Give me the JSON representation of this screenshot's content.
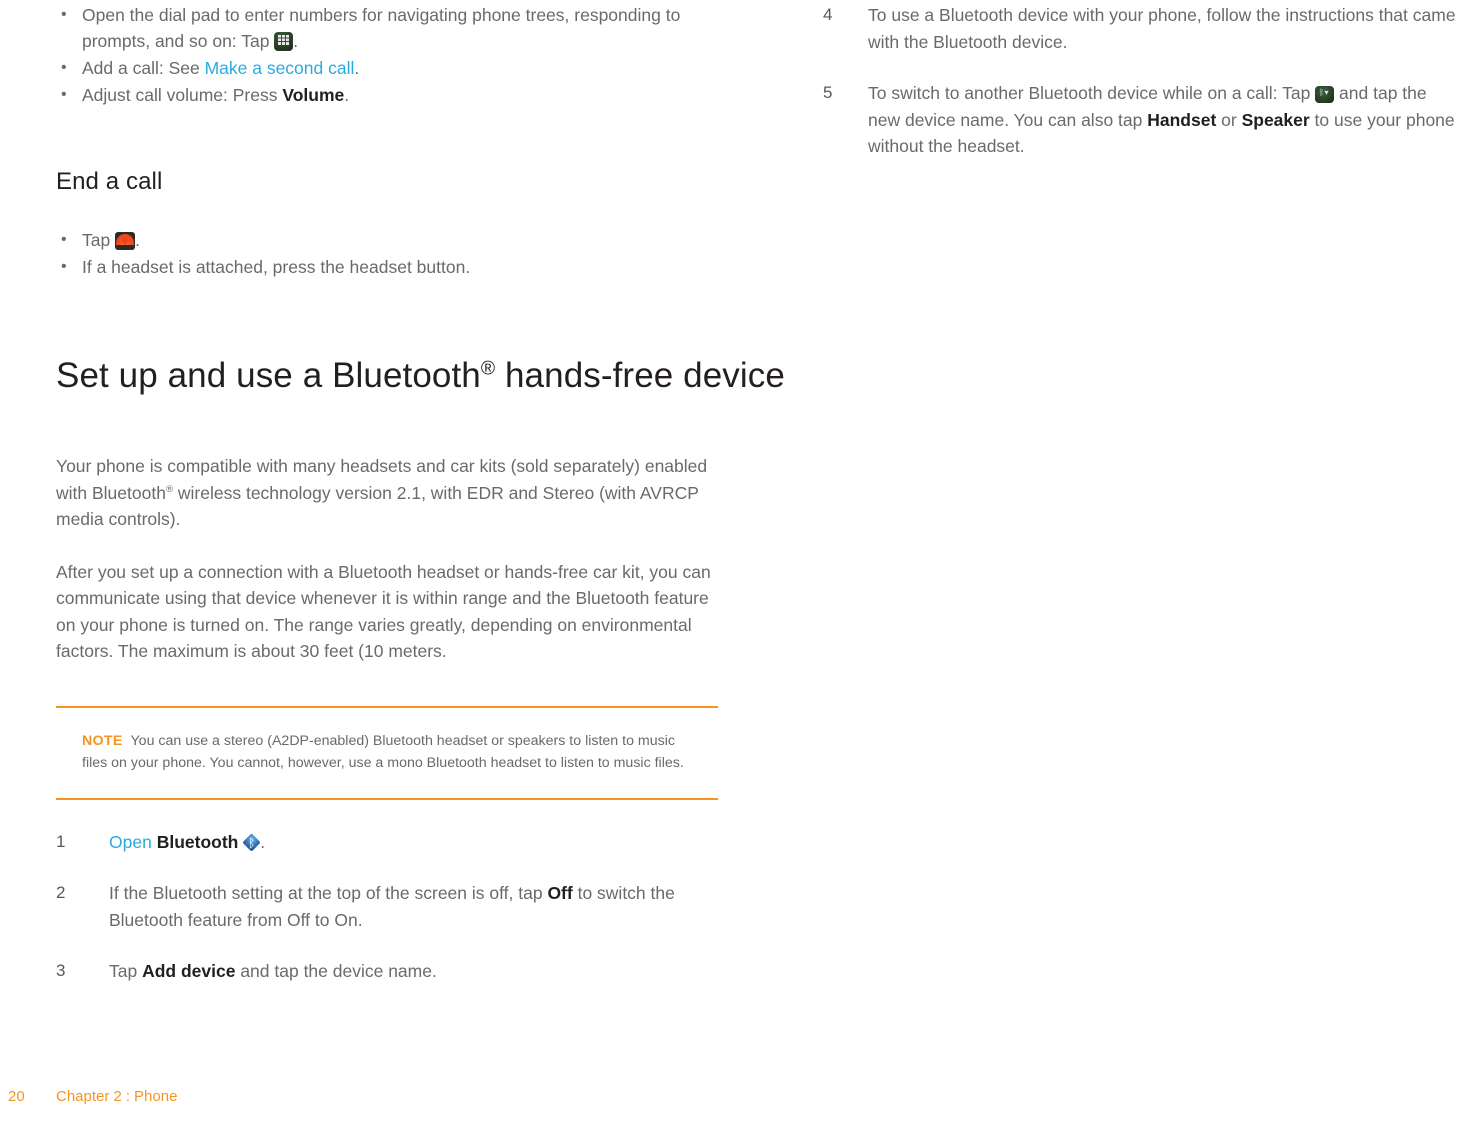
{
  "document": {
    "footer": {
      "page_number": "20",
      "chapter": "Chapter 2",
      "separator": ":",
      "section": "Phone"
    },
    "colors": {
      "accent_orange": "#f7941e",
      "link_blue": "#29abe2",
      "body_gray": "#6a6a6c",
      "heading_black": "#231f20"
    }
  },
  "left_column": {
    "call_options_bullets": [
      {
        "text_before": "Open the dial pad to enter numbers for navigating phone trees, responding to prompts, and so on: Tap ",
        "icon": "dialpad-icon",
        "text_after": "."
      },
      {
        "text_before": "Add a call: See ",
        "link": "Make a second call",
        "text_after": "."
      },
      {
        "text_before": "Adjust call volume: Press ",
        "bold": "Volume",
        "text_after": "."
      }
    ],
    "end_a_call": {
      "heading": "End a call",
      "bullets": [
        {
          "text_before": "Tap ",
          "icon": "end-call-icon",
          "text_after": "."
        },
        {
          "text_before": "If a headset is attached, press the headset button."
        }
      ]
    },
    "bluetooth_section": {
      "heading_part1": "Set up and use a Bluetooth",
      "heading_reg": "®",
      "heading_part2": " hands-free device",
      "paragraph_1_part1": "Your phone is compatible with many headsets and car kits (sold separately) enabled with Bluetooth",
      "paragraph_1_reg": "®",
      "paragraph_1_part2": " wireless technology version 2.1, with EDR and Stereo (with AVRCP media controls).",
      "paragraph_2": "After you set up a connection with a Bluetooth headset or hands-free car kit, you can communicate using that device whenever it is within range and the Bluetooth feature on your phone is turned on. The range varies greatly, depending on environmental factors. The maximum is about 30 feet (10 meters.",
      "note": {
        "label": "NOTE",
        "text": "You can use a stereo (A2DP-enabled) Bluetooth headset or speakers to listen to music files on your phone. You cannot, however, use a mono Bluetooth headset to listen to music files."
      },
      "steps": [
        {
          "number": "1",
          "link": "Open",
          "space": " ",
          "bold": "Bluetooth",
          "icon": "bluetooth-icon",
          "text_after": "."
        },
        {
          "number": "2",
          "text_before": "If the Bluetooth setting at the top of the screen is off, tap ",
          "bold": "Off",
          "text_after": " to switch the Bluetooth feature from Off to On."
        },
        {
          "number": "3",
          "text_before": "Tap ",
          "bold": "Add device",
          "text_after": " and tap the device name."
        }
      ]
    }
  },
  "right_column": {
    "steps": [
      {
        "number": "4",
        "text_before": "To use a Bluetooth device with your phone, follow the instructions that came with the Bluetooth device."
      },
      {
        "number": "5",
        "text_before": "To switch to another Bluetooth device while on a call: Tap ",
        "icon": "bluetooth-device-icon",
        "text_mid": " and tap the new device name. You can also tap ",
        "bold_1": "Handset",
        "text_or": " or ",
        "bold_2": "Speaker",
        "text_after": " to use your phone without the headset."
      }
    ]
  }
}
